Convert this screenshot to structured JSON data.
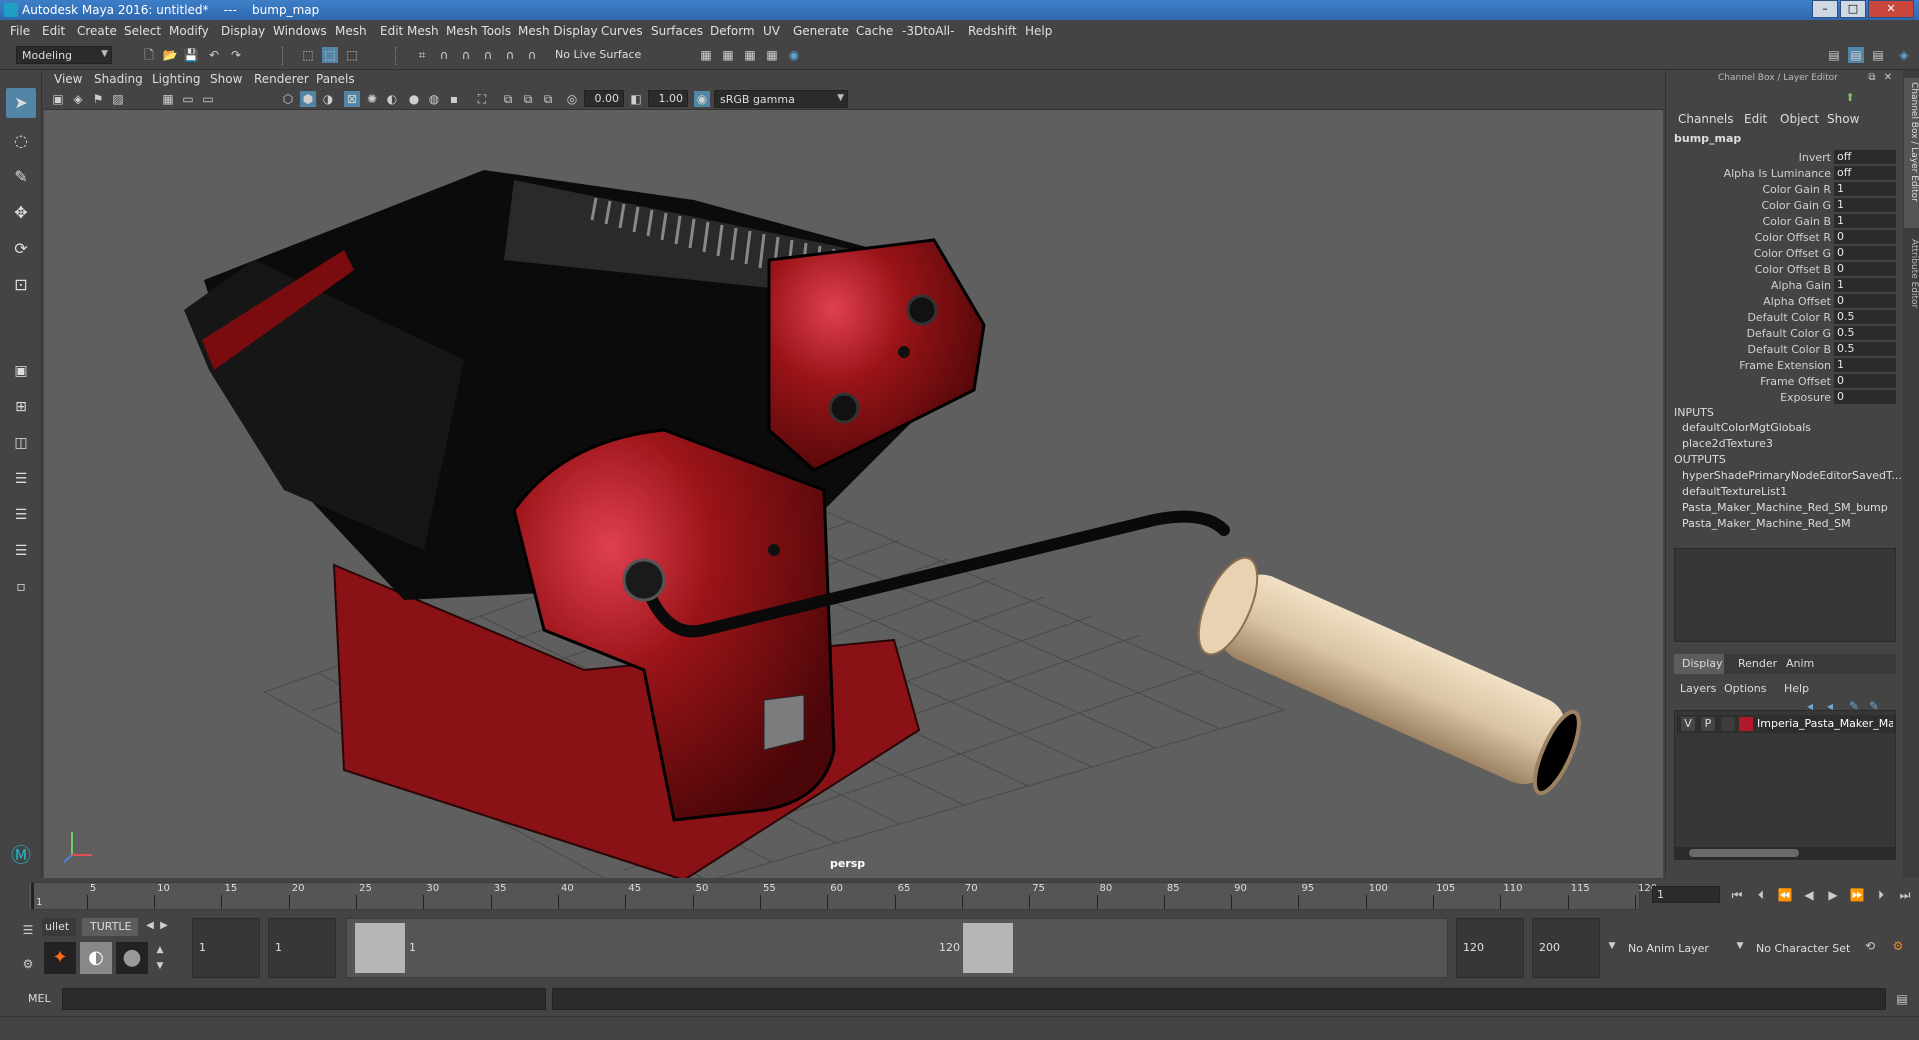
{
  "window": {
    "title": "Autodesk Maya 2016: untitled*    ---    bump_map",
    "buttons": {
      "min": "–",
      "max": "□",
      "close": "✕"
    }
  },
  "menubar": [
    "File",
    "Edit",
    "Create",
    "Select",
    "Modify",
    "Display",
    "Windows",
    "Mesh",
    "Edit Mesh",
    "Mesh Tools",
    "Mesh Display",
    "Curves",
    "Surfaces",
    "Deform",
    "UV",
    "Generate",
    "Cache",
    "-3DtoAll-",
    "Redshift",
    "Help"
  ],
  "toolbar": {
    "mode": "Modeling",
    "live_surface": "No Live Surface"
  },
  "viewport": {
    "menu": [
      "View",
      "Shading",
      "Lighting",
      "Show",
      "Renderer",
      "Panels"
    ],
    "exposure": "0.00",
    "gamma": "1.00",
    "color_space": "sRGB gamma",
    "camera": "persp"
  },
  "channel_box": {
    "panel_title": "Channel Box / Layer Editor",
    "menu": [
      "Channels",
      "Edit",
      "Object",
      "Show"
    ],
    "node": "bump_map",
    "attributes": [
      {
        "label": "Invert",
        "value": "off"
      },
      {
        "label": "Alpha Is Luminance",
        "value": "off"
      },
      {
        "label": "Color Gain R",
        "value": "1"
      },
      {
        "label": "Color Gain G",
        "value": "1"
      },
      {
        "label": "Color Gain B",
        "value": "1"
      },
      {
        "label": "Color Offset R",
        "value": "0"
      },
      {
        "label": "Color Offset G",
        "value": "0"
      },
      {
        "label": "Color Offset B",
        "value": "0"
      },
      {
        "label": "Alpha Gain",
        "value": "1"
      },
      {
        "label": "Alpha Offset",
        "value": "0"
      },
      {
        "label": "Default Color R",
        "value": "0.5"
      },
      {
        "label": "Default Color G",
        "value": "0.5"
      },
      {
        "label": "Default Color B",
        "value": "0.5"
      },
      {
        "label": "Frame Extension",
        "value": "1"
      },
      {
        "label": "Frame Offset",
        "value": "0"
      },
      {
        "label": "Exposure",
        "value": "0"
      }
    ],
    "inputs_header": "INPUTS",
    "inputs": [
      "defaultColorMgtGlobals",
      "place2dTexture3"
    ],
    "outputs_header": "OUTPUTS",
    "outputs": [
      "hyperShadePrimaryNodeEditorSavedT...",
      "defaultTextureList1",
      "Pasta_Maker_Machine_Red_SM_bump",
      "Pasta_Maker_Machine_Red_SM"
    ],
    "side_tabs": [
      "Channel Box / Layer Editor",
      "Attribute Editor"
    ]
  },
  "layer_editor": {
    "tabs": [
      "Display",
      "Render",
      "Anim"
    ],
    "menu": [
      "Layers",
      "Options",
      "Help"
    ],
    "layer": {
      "v": "V",
      "p": "P",
      "name": "Imperia_Pasta_Maker_Ma",
      "color": "#b0182c"
    }
  },
  "timeline": {
    "ticks": [
      "1",
      "5",
      "10",
      "15",
      "20",
      "25",
      "30",
      "35",
      "40",
      "45",
      "50",
      "55",
      "60",
      "65",
      "70",
      "75",
      "80",
      "85",
      "90",
      "95",
      "100",
      "105",
      "110",
      "115",
      "120"
    ],
    "current_frame": "1"
  },
  "range": {
    "shelf_tabs": [
      "ullet",
      "TURTLE"
    ],
    "start": "1",
    "playback_start": "1",
    "slider_start": "1",
    "slider_end": "120",
    "playback_end": "120",
    "end": "200",
    "anim_layer": "No Anim Layer",
    "character_set": "No Character Set"
  },
  "cmdline": {
    "lang": "MEL"
  },
  "colors": {
    "accent": "#5285a6",
    "body_red": "#9a1418",
    "handle_wood": "#d9c4a4"
  }
}
